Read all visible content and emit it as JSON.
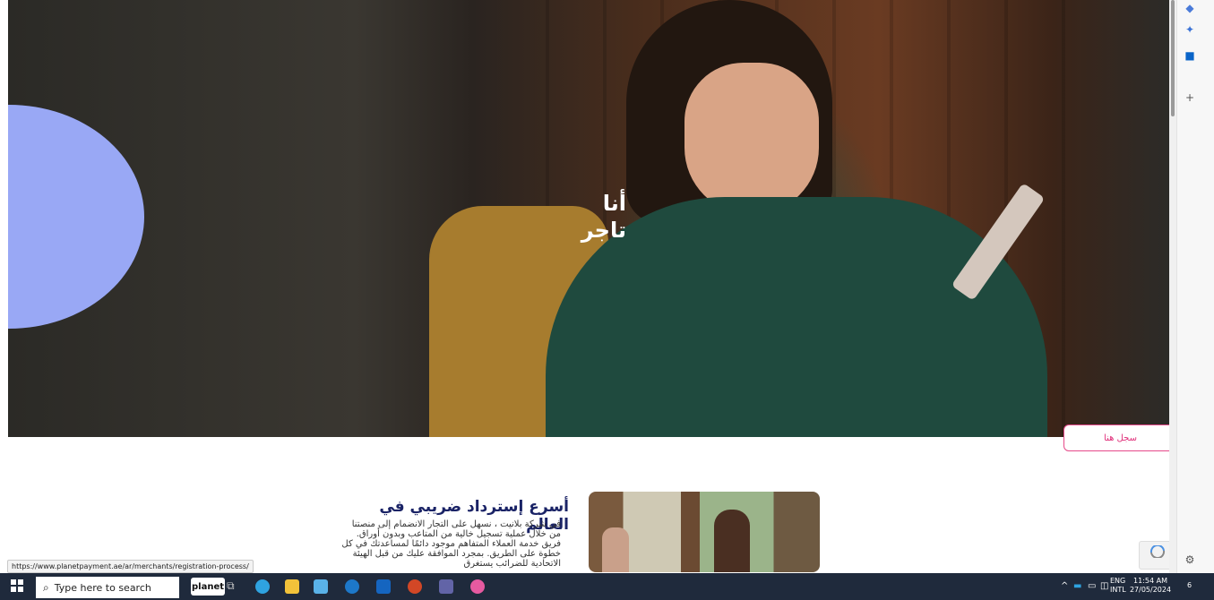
{
  "hero": {
    "headline_line1": "أنا",
    "headline_line2": "تاجر",
    "register_button": "سجل هنا"
  },
  "content": {
    "title": "أسرع إسترداد ضريبي في العالم",
    "body": "في شركة بلانيت ، نسهل على التجار الانضمام إلى منصتنا من خلال عملية تسجيل خالية من المتاعب وبدون أوراق. فريق خدمة العملاء المتفاهم موجود دائمًا لمساعدتك في كل خطوة على الطريق. بمجرد الموافقة عليك من قبل الهيئة الاتحادية للضرائب يستغرق"
  },
  "status_url": "https://www.planetpayment.ae/ar/merchants/registration-process/",
  "sidebar": {
    "icons": [
      "tag-icon",
      "copilot-icon",
      "outlook-icon",
      "plus-icon",
      "settings-icon"
    ]
  },
  "taskbar": {
    "search_placeholder": "Type here to search",
    "planet_label": "planet",
    "apps": [
      "task-view-icon",
      "edge-icon",
      "file-explorer-icon",
      "store-icon",
      "webex-icon",
      "outlook-icon",
      "powerpoint-icon",
      "teams-icon",
      "paint-icon"
    ],
    "language_line1": "ENG",
    "language_line2": "INTL",
    "time": "11:54 AM",
    "date": "27/05/2024",
    "notification_count": "6"
  }
}
